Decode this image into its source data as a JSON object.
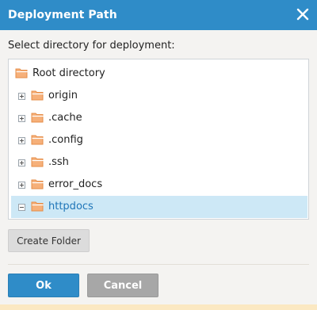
{
  "dialog": {
    "title": "Deployment Path",
    "close_icon": "close-icon"
  },
  "prompt": "Select directory for deployment:",
  "tree": {
    "root": {
      "label": "Root directory",
      "icon": "folder-open-icon"
    },
    "items": [
      {
        "label": "origin",
        "expander": "plus",
        "selected": false
      },
      {
        "label": ".cache",
        "expander": "plus",
        "selected": false
      },
      {
        "label": ".config",
        "expander": "plus",
        "selected": false
      },
      {
        "label": ".ssh",
        "expander": "plus",
        "selected": false
      },
      {
        "label": "error_docs",
        "expander": "plus",
        "selected": false
      },
      {
        "label": "httpdocs",
        "expander": "minus",
        "selected": true
      }
    ]
  },
  "buttons": {
    "create_folder": "Create Folder",
    "ok": "Ok",
    "cancel": "Cancel"
  },
  "colors": {
    "titlebar": "#2f8cc8",
    "selected_row": "#cde8f6",
    "selected_text": "#1f75b8",
    "folder": "#f4a460"
  }
}
